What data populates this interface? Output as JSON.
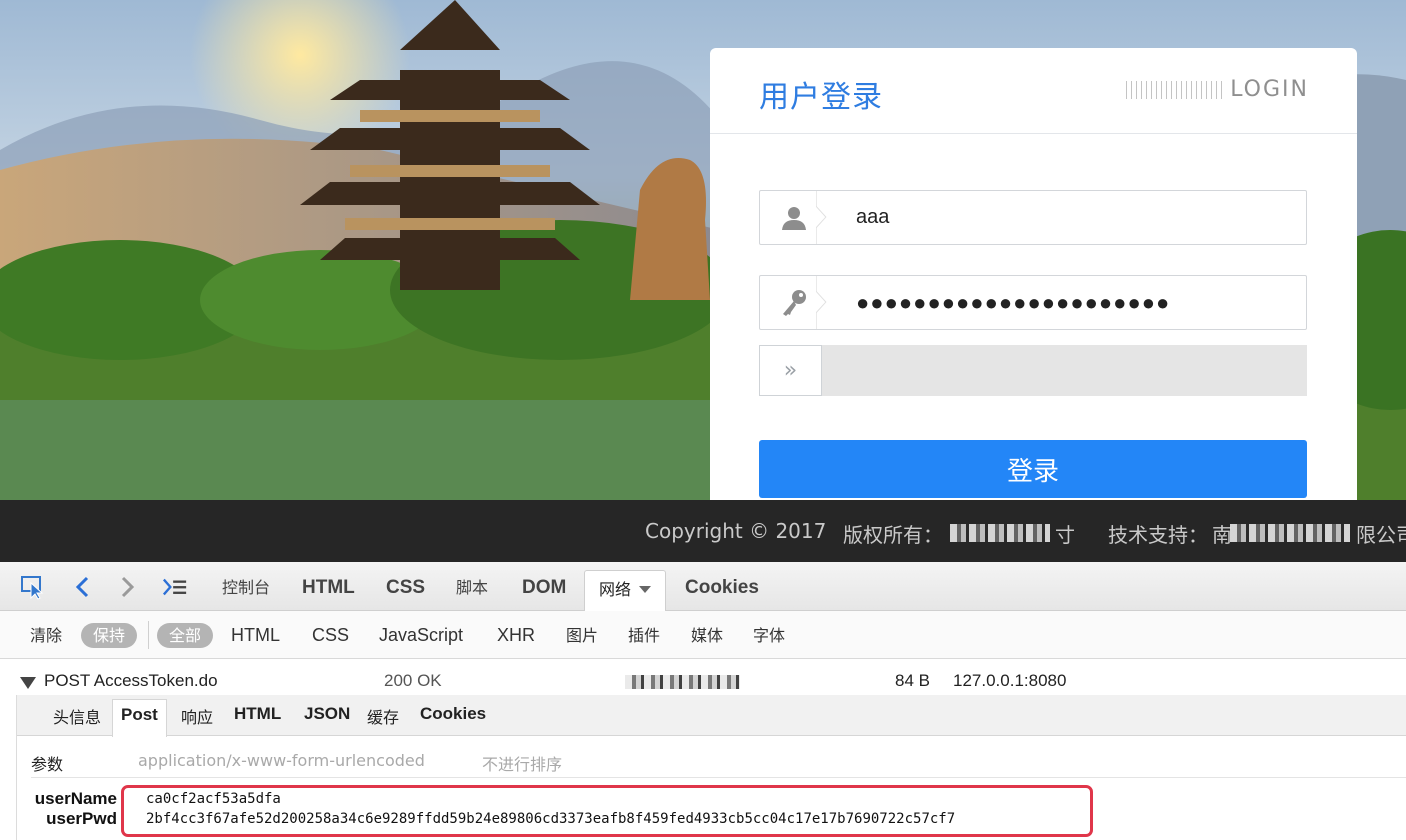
{
  "login": {
    "title": "用户登录",
    "title_en": "LOGIN",
    "username_value": "aaa",
    "password_value": "●●●●●●●●●●●●●●●●●●●●●●",
    "slider_arrow": "»",
    "submit_label": "登录"
  },
  "footer": {
    "copyright": "Copyright © 2017",
    "owner_label": "版权所有：",
    "owner_trailing": "寸",
    "support_label": "技术支持：",
    "support_lead": "南",
    "support_trailing": "限公司"
  },
  "devtools": {
    "tabs": {
      "console": "控制台",
      "html": "HTML",
      "css": "CSS",
      "script": "脚本",
      "dom": "DOM",
      "net": "网络",
      "cookies": "Cookies"
    },
    "filters": {
      "clear": "清除",
      "persist": "保持",
      "all": "全部",
      "html": "HTML",
      "css": "CSS",
      "js": "JavaScript",
      "xhr": "XHR",
      "images": "图片",
      "plugins": "插件",
      "media": "媒体",
      "fonts": "字体"
    },
    "request": {
      "method_url": "POST AccessToken.do",
      "status": "200 OK",
      "size": "84 B",
      "remote": "127.0.0.1:8080"
    },
    "detail_tabs": {
      "headers": "头信息",
      "post": "Post",
      "response": "响应",
      "html": "HTML",
      "json": "JSON",
      "cache": "缓存",
      "cookies": "Cookies"
    },
    "params": {
      "label": "参数",
      "content_type": "application/x-www-form-urlencoded",
      "no_sort": "不进行排序",
      "rows": [
        {
          "key": "userName",
          "value": "ca0cf2acf53a5dfa"
        },
        {
          "key": "userPwd",
          "value": "2bf4cc3f67afe52d200258a34c6e9289ffdd59b24e89806cd3373eafb8f459fed4933cb5cc04c17e17b7690722c57cf7"
        }
      ]
    }
  },
  "colors": {
    "accent": "#2386f7",
    "title_blue": "#2f7de1",
    "footer_bg": "#262626",
    "highlight": "#e0364a"
  }
}
